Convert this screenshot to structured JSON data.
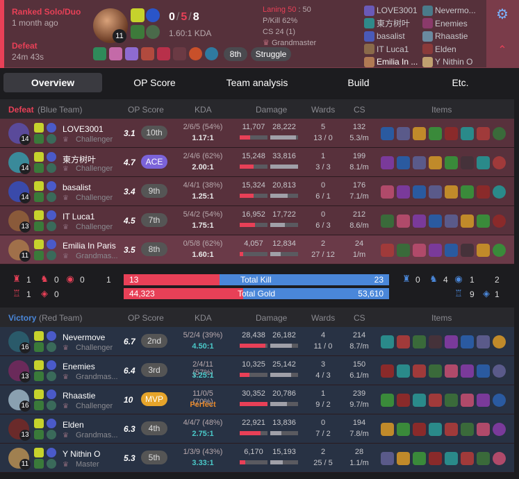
{
  "summary": {
    "mode": "Ranked Solo/Duo",
    "ago": "1 month ago",
    "result": "Defeat",
    "duration": "24m 43s",
    "champ_level": "11",
    "kills": "0",
    "deaths": "5",
    "assists": "8",
    "kda_ratio": "1.60:1 KDA",
    "laning_label": "Laning 50",
    "laning_score": "50",
    "pkill": "P/Kill 62%",
    "cs": "CS 24 (1)",
    "tier": "Grandmaster",
    "tag1": "8th",
    "tag2": "Struggle"
  },
  "participants": {
    "left": [
      "LOVE3001",
      "東方树叶",
      "basalist",
      "IT Luca1",
      "Emilia In ..."
    ],
    "right": [
      "Nevermo...",
      "Enemies",
      "Rhaastie",
      "Elden",
      "Y Nithin O"
    ]
  },
  "tabs": [
    "Overview",
    "OP Score",
    "Team analysis",
    "Build",
    "Etc."
  ],
  "headers": {
    "op": "OP Score",
    "kda": "KDA",
    "damage": "Damage",
    "wards": "Wards",
    "cs": "CS",
    "items": "Items"
  },
  "blue": {
    "result": "Defeat",
    "team": "(Blue Team)",
    "colors": {
      "accent": "#e84057"
    },
    "players": [
      {
        "name": "LOVE3001",
        "rank": "Challenger",
        "lvl": "14",
        "score": "3.1",
        "tag": "10th",
        "kda": "2/6/5 (54%)",
        "ratio": "1.17:1",
        "dmg": "11,707",
        "taken": "28,222",
        "dmgf": 0.38,
        "takenf": 0.92,
        "wards": "5",
        "wards2": "13 / 0",
        "cs": "132",
        "csm": "5.3/m"
      },
      {
        "name": "東方树叶",
        "rank": "Challenger",
        "lvl": "14",
        "score": "4.7",
        "tag": "ACE",
        "kda": "2/4/6 (62%)",
        "ratio": "2.00:1",
        "dmg": "15,248",
        "taken": "33,816",
        "dmgf": 0.5,
        "takenf": 1.0,
        "wards": "1",
        "wards2": "3 / 3",
        "cs": "199",
        "csm": "8.1/m"
      },
      {
        "name": "basalist",
        "rank": "Challenger",
        "lvl": "14",
        "score": "3.4",
        "tag": "9th",
        "kda": "4/4/1 (38%)",
        "ratio": "1.25:1",
        "dmg": "15,324",
        "taken": "20,813",
        "dmgf": 0.5,
        "takenf": 0.62,
        "wards": "0",
        "wards2": "6 / 1",
        "cs": "176",
        "csm": "7.1/m"
      },
      {
        "name": "IT Luca1",
        "rank": "Challenger",
        "lvl": "13",
        "score": "4.5",
        "tag": "7th",
        "kda": "5/4/2 (54%)",
        "ratio": "1.75:1",
        "dmg": "16,952",
        "taken": "17,722",
        "dmgf": 0.55,
        "takenf": 0.52,
        "wards": "0",
        "wards2": "6 / 3",
        "cs": "212",
        "csm": "8.6/m"
      },
      {
        "name": "Emilia In Paris",
        "rank": "Grandmas...",
        "lvl": "11",
        "score": "3.5",
        "tag": "8th",
        "kda": "0/5/8 (62%)",
        "ratio": "1.60:1",
        "dmg": "4,057",
        "taken": "12,834",
        "dmgf": 0.13,
        "takenf": 0.38,
        "wards": "2",
        "wards2": "27 / 12",
        "cs": "24",
        "csm": "1/m"
      }
    ]
  },
  "red": {
    "result": "Victory",
    "team": "(Red Team)",
    "players": [
      {
        "name": "Nevermove",
        "rank": "Challenger",
        "lvl": "16",
        "score": "6.7",
        "tag": "2nd",
        "kda": "5/2/4 (39%)",
        "ratio": "4.50:1",
        "dmg": "28,438",
        "taken": "26,182",
        "dmgf": 0.93,
        "takenf": 0.77,
        "wards": "4",
        "wards2": "11 / 0",
        "cs": "214",
        "csm": "8.7/m"
      },
      {
        "name": "Enemies",
        "rank": "Grandmas...",
        "lvl": "13",
        "score": "6.4",
        "tag": "3rd",
        "kda": "2/4/11 (57%)",
        "ratio": "3.25:1",
        "dmg": "10,325",
        "taken": "25,142",
        "dmgf": 0.34,
        "takenf": 0.74,
        "wards": "3",
        "wards2": "4 / 3",
        "cs": "150",
        "csm": "6.1/m"
      },
      {
        "name": "Rhaastie",
        "rank": "Challenger",
        "lvl": "16",
        "score": "10",
        "tag": "MVP",
        "kda": "11/0/5 (70%)",
        "ratio": "Perfect",
        "dmg": "30,352",
        "taken": "20,786",
        "dmgf": 1.0,
        "takenf": 0.61,
        "wards": "1",
        "wards2": "9 / 2",
        "cs": "239",
        "csm": "9.7/m"
      },
      {
        "name": "Elden",
        "rank": "Grandmas...",
        "lvl": "13",
        "score": "6.3",
        "tag": "4th",
        "kda": "4/4/7 (48%)",
        "ratio": "2.75:1",
        "dmg": "22,921",
        "taken": "13,836",
        "dmgf": 0.75,
        "takenf": 0.41,
        "wards": "0",
        "wards2": "7 / 2",
        "cs": "194",
        "csm": "7.8/m"
      },
      {
        "name": "Y Nithin O",
        "rank": "Master",
        "lvl": "11",
        "score": "5.3",
        "tag": "5th",
        "kda": "1/3/9 (43%)",
        "ratio": "3.33:1",
        "dmg": "6,170",
        "taken": "15,193",
        "dmgf": 0.2,
        "takenf": 0.45,
        "wards": "2",
        "wards2": "25 / 5",
        "cs": "28",
        "csm": "1.1/m"
      }
    ]
  },
  "totals": {
    "kill_label": "Total Kill",
    "gold_label": "Total Gold",
    "blue_kill": "13",
    "red_kill": "23",
    "blue_gold": "44,323",
    "red_gold": "53,610",
    "kill_frac": 0.36,
    "gold_frac": 0.45,
    "blue_obj": [
      "1",
      "0",
      "0",
      "1",
      "1",
      "0"
    ],
    "red_obj": [
      "0",
      "4",
      "1",
      "2",
      "9",
      "1"
    ]
  }
}
